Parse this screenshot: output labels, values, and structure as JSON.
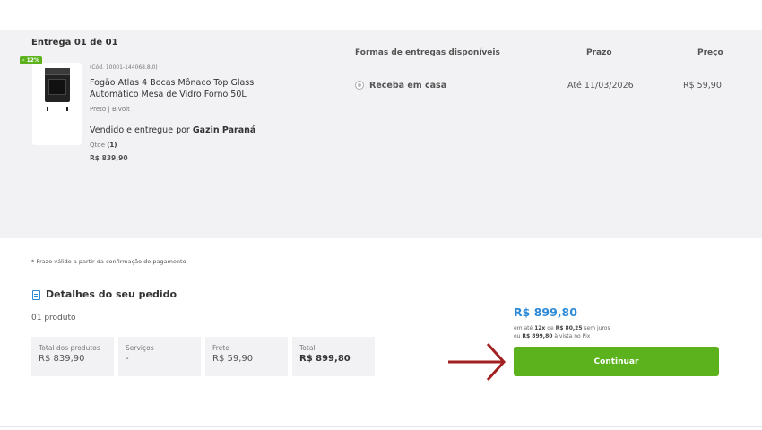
{
  "delivery": {
    "title": "Entrega 01 de 01",
    "discount_badge": "- 12%",
    "product": {
      "code": "(Cód. 10001-144068.8.0)",
      "name": "Fogão Atlas 4 Bocas Mônaco Top Glass Automático Mesa de Vidro Forno 50L",
      "variant": "Preto | Bivolt",
      "seller_prefix": "Vendido e entregue por ",
      "seller_name": "Gazin Paraná",
      "qty_label": "Qtde ",
      "qty_value": "(1)",
      "price": "R$ 839,90"
    },
    "columns": {
      "options": "Formas de entregas disponíveis",
      "deadline": "Prazo",
      "price": "Preço"
    },
    "option": {
      "label": "Receba em casa",
      "date": "Até 11/03/2026",
      "price": "R$ 59,90",
      "selected": true
    }
  },
  "note": "* Prazo válido a partir da confirmação do pagamento",
  "details": {
    "title": "Detalhes do seu pedido",
    "count": "01 produto",
    "boxes": [
      {
        "label": "Total dos produtos",
        "value": "R$ 839,90"
      },
      {
        "label": "Serviços",
        "value": "-"
      },
      {
        "label": "Frete",
        "value": "R$ 59,90"
      },
      {
        "label": "Total",
        "value": "R$ 899,80"
      }
    ]
  },
  "summary": {
    "total": "R$ 899,80",
    "inst_prefix": "em até ",
    "inst_count": "12x",
    "inst_mid": " de ",
    "inst_value": "R$ 80,25",
    "inst_suffix": " sem juros",
    "pix_prefix": "ou ",
    "pix_value": "R$ 899,80",
    "pix_suffix": " à vista no Pix",
    "continue_label": "Continuar"
  },
  "colors": {
    "accent_green": "#5cb21c",
    "accent_blue": "#2d8ad6",
    "arrow_red": "#a32020"
  },
  "icons": {
    "details": "document-icon",
    "annotation": "arrow-right-icon"
  }
}
